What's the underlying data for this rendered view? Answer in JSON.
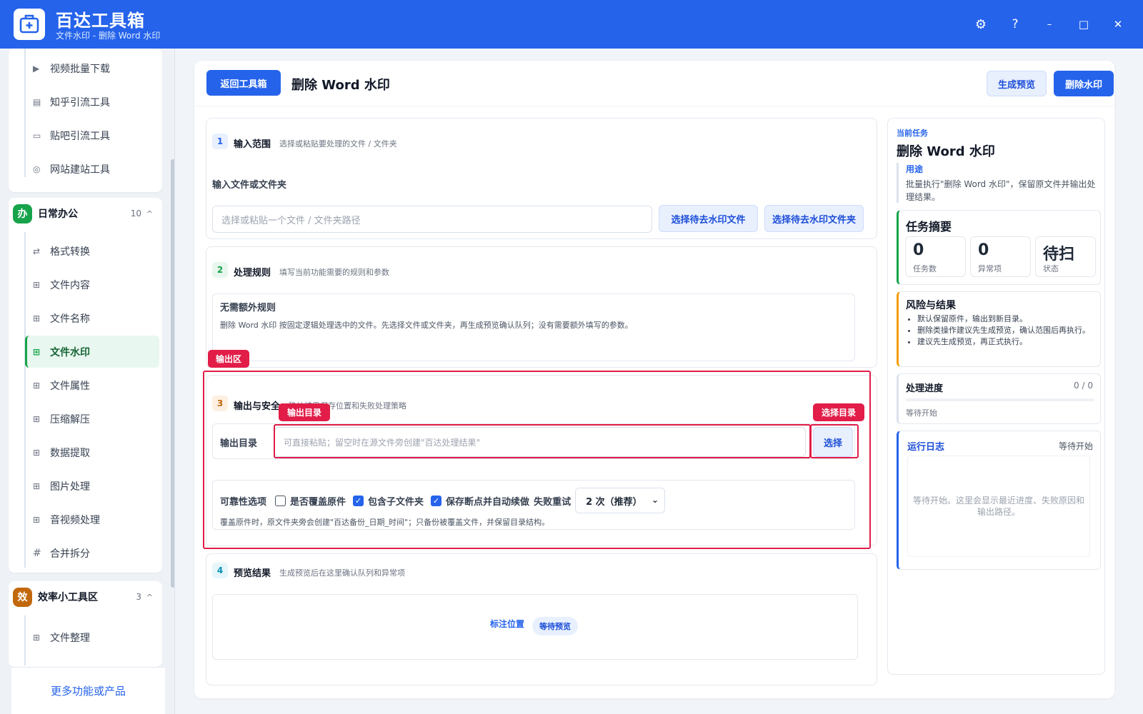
{
  "window": {
    "title": "百达工具箱",
    "subtitle": "文件水印 - 删除 Word 水印",
    "settings_glyph": "⚙",
    "help_glyph": "?",
    "min_glyph": "–",
    "max_glyph": "□",
    "close_glyph": "✕"
  },
  "sidebar": {
    "top_items": [
      {
        "label": "视频批量下载",
        "icon": "video-icon"
      },
      {
        "label": "知乎引流工具",
        "icon": "document-icon"
      },
      {
        "label": "贴吧引流工具",
        "icon": "message-icon"
      },
      {
        "label": "网站建站工具",
        "icon": "globe-icon"
      }
    ],
    "groups": [
      {
        "badge": "办",
        "title": "日常办公",
        "count": "10",
        "color": "#16a34a",
        "items": [
          {
            "label": "格式转换",
            "icon": "swap-icon",
            "glyph": "⇄"
          },
          {
            "label": "文件内容",
            "icon": "grid-icon",
            "glyph": "⊞"
          },
          {
            "label": "文件名称",
            "icon": "grid-icon",
            "glyph": "⊞"
          },
          {
            "label": "文件水印",
            "icon": "grid-icon",
            "glyph": "⊞"
          },
          {
            "label": "文件属性",
            "icon": "grid-icon",
            "glyph": "⊞"
          },
          {
            "label": "压缩解压",
            "icon": "grid-icon",
            "glyph": "⊞"
          },
          {
            "label": "数据提取",
            "icon": "grid-icon",
            "glyph": "⊞"
          },
          {
            "label": "图片处理",
            "icon": "grid-icon",
            "glyph": "⊞"
          },
          {
            "label": "音视频处理",
            "icon": "grid-icon",
            "glyph": "⊞"
          },
          {
            "label": "合并拆分",
            "icon": "hash-icon",
            "glyph": "#"
          }
        ]
      },
      {
        "badge": "效",
        "title": "效率小工具区",
        "count": "3",
        "color": "#c2680c",
        "items": [
          {
            "label": "文件整理",
            "icon": "grid-icon",
            "glyph": "⊞"
          }
        ]
      }
    ],
    "more_link": "更多功能或产品"
  },
  "toolbar": {
    "back": "返回工具箱",
    "page_title": "删除 Word 水印",
    "preview": "生成预览",
    "run": "删除水印"
  },
  "sections": {
    "input": {
      "num": "1",
      "title": "输入范围",
      "desc": "选择或粘贴要处理的文件 / 文件夹",
      "field_label": "输入文件或文件夹",
      "placeholder": "选择或粘贴一个文件 / 文件夹路径",
      "pick_file": "选择待去水印文件",
      "pick_folder": "选择待去水印文件夹"
    },
    "rules": {
      "num": "2",
      "title": "处理规则",
      "desc": "填写当前功能需要的规则和参数",
      "box_title": "无需额外规则",
      "box_text": "删除 Word 水印 按固定逻辑处理选中的文件。先选择文件或文件夹，再生成预览确认队列；没有需要额外填写的参数。"
    },
    "output": {
      "num": "3",
      "title": "输出与安全",
      "desc": "确认结果保存位置和失败处理策略",
      "dir_label": "输出目录",
      "dir_placeholder": "可直接粘贴；留空时在源文件旁创建\"百达处理结果\"",
      "choose": "选择",
      "reliability_label": "可靠性选项",
      "overwrite": "是否覆盖原件",
      "overwrite_checked": false,
      "subfolders": "包含子文件夹",
      "subfolders_checked": true,
      "resume": "保存断点并自动续做",
      "resume_checked": true,
      "retry_label": "失败重试",
      "retry_value": "2 次（推荐）",
      "note": "覆盖原件时，原文件夹旁会创建\"百达备份_日期_时间\"；只备份被覆盖文件，并保留目录结构。"
    },
    "preview": {
      "num": "4",
      "title": "预览结果",
      "desc": "生成预览后在这里确认队列和异常项",
      "mark_pos": "标注位置",
      "status": "等待预览"
    }
  },
  "annotations": {
    "output_area": "输出区",
    "output_dir": "输出目录",
    "choose_dir": "选择目录"
  },
  "right": {
    "current_label": "当前任务",
    "task_title": "删除 Word 水印",
    "purpose_label": "用途",
    "purpose_text": "批量执行\"删除 Word 水印\"，保留原文件并输出处理结果。",
    "summary_title": "任务摘要",
    "summary": [
      {
        "value": "0",
        "label": "任务数"
      },
      {
        "value": "0",
        "label": "异常项"
      },
      {
        "value": "待扫",
        "label": "状态"
      }
    ],
    "risk_title": "风险与结果",
    "risks": [
      "默认保留原件，输出到新目录。",
      "删除类操作建议先生成预览，确认范围后再执行。",
      "建议先生成预览，再正式执行。"
    ],
    "progress_title": "处理进度",
    "progress_count": "0 / 0",
    "progress_fraction": 0,
    "progress_status": "等待开始",
    "log_title": "运行日志",
    "log_status": "等待开始",
    "log_text": "等待开始。这里会显示最近进度、失败原因和输出路径。"
  },
  "colors": {
    "brand": "#2563eb",
    "annotation": "#e11d48",
    "active": "#16a34a"
  }
}
